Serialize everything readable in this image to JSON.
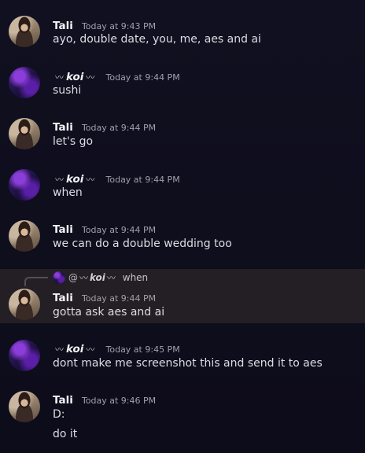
{
  "messages": [
    {
      "author": "Tali",
      "avatar": "tali-avatar",
      "time": "Today at 9:43 PM",
      "lines": [
        "ayo, double date, you, me, aes and ai"
      ]
    },
    {
      "author": "koi",
      "decor_left": "〰",
      "decor_right": "〰",
      "avatar": "koi-avatar",
      "time": "Today at 9:44 PM",
      "lines": [
        "sushi"
      ]
    },
    {
      "author": "Tali",
      "avatar": "tali-avatar",
      "time": "Today at 9:44 PM",
      "lines": [
        "let's go"
      ]
    },
    {
      "author": "koi",
      "decor_left": "〰",
      "decor_right": "〰",
      "avatar": "koi-avatar",
      "time": "Today at 9:44 PM",
      "lines": [
        "when"
      ]
    },
    {
      "author": "Tali",
      "avatar": "tali-avatar",
      "time": "Today at 9:44 PM",
      "lines": [
        "we can do a double wedding too"
      ]
    },
    {
      "author": "Tali",
      "avatar": "tali-avatar",
      "time": "Today at 9:44 PM",
      "lines": [
        "gotta ask aes and ai"
      ],
      "reply": {
        "mention": "@",
        "author": "koi",
        "text": "when"
      }
    },
    {
      "author": "koi",
      "decor_left": "〰",
      "decor_right": "〰",
      "avatar": "koi-avatar",
      "time": "Today at 9:45 PM",
      "lines": [
        "dont make me screenshot this and send it to aes"
      ]
    },
    {
      "author": "Tali",
      "avatar": "tali-avatar",
      "time": "Today at 9:46 PM",
      "lines": [
        "D:",
        "do it"
      ]
    }
  ],
  "colors": {
    "background": "#0f0e1d",
    "highlight": "#231f24",
    "username": "#f2f3f5",
    "timestamp": "#a0a0ac",
    "message_text": "#dcdde4"
  }
}
